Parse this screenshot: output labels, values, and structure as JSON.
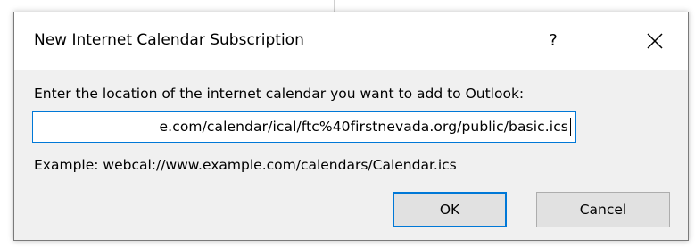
{
  "dialog": {
    "title": "New Internet Calendar Subscription",
    "help_label": "?",
    "close_icon": "close-icon",
    "prompt": "Enter the location of the internet calendar you want to add to Outlook:",
    "url_value": "e.com/calendar/ical/ftc%40firstnevada.org/public/basic.ics",
    "example": "Example: webcal://www.example.com/calendars/Calendar.ics",
    "ok_label": "OK",
    "cancel_label": "Cancel"
  },
  "colors": {
    "accent": "#0078d7",
    "dialog_bg": "#f0f0f0",
    "button_bg": "#e1e1e1"
  }
}
